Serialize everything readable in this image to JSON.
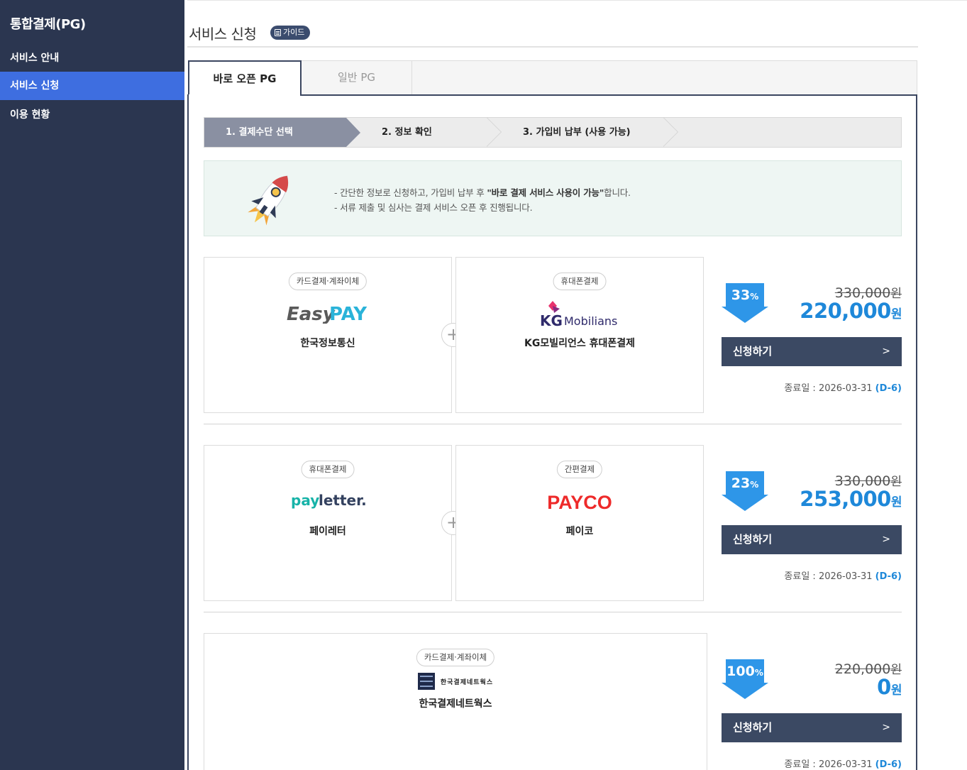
{
  "sidebar": {
    "title": "통합결제(PG)",
    "items": [
      {
        "label": "서비스 안내"
      },
      {
        "label": "서비스 신청"
      },
      {
        "label": "이용 현황"
      }
    ]
  },
  "header": {
    "title": "서비스 신청",
    "guide_label": "가이드"
  },
  "tabs": [
    {
      "label": "바로 오픈 PG"
    },
    {
      "label": "일반 PG"
    }
  ],
  "steps": [
    {
      "label": "1. 결제수단 선택"
    },
    {
      "label": "2. 정보 확인"
    },
    {
      "label": "3. 가입비 납부 (사용 가능)"
    }
  ],
  "info": {
    "line1_pre": "- 간단한 정보로 신청하고, 가입비 납부 후 ",
    "line1_bold": "\"바로 결제 서비스 사용이 가능\"",
    "line1_post": "합니다.",
    "line2": "- 서류 제출 및 심사는 결제 서비스 오픈 후 진행됩니다.",
    "rocket_label": "PG"
  },
  "offers": [
    {
      "cards": [
        {
          "tag": "카드결제·계좌이체",
          "logo": "Easy PAY",
          "name": "한국정보통신"
        },
        {
          "tag": "휴대폰결제",
          "logo": "Mobilians",
          "name": "KG모빌리언스 휴대폰결제"
        }
      ],
      "discount": "33",
      "discount_unit": "%",
      "original_price": "330,000",
      "price": "220,000",
      "currency": "원",
      "button_label": "신청하기",
      "end_label": "종료일 : 2026-03-31",
      "dday": "(D-6)"
    },
    {
      "cards": [
        {
          "tag": "휴대폰결제",
          "logo": "payletter.",
          "name": "페이레터"
        },
        {
          "tag": "간편결제",
          "logo": "PAYCO",
          "name": "페이코"
        }
      ],
      "discount": "23",
      "discount_unit": "%",
      "original_price": "330,000",
      "price": "253,000",
      "currency": "원",
      "button_label": "신청하기",
      "end_label": "종료일 : 2026-03-31",
      "dday": "(D-6)"
    },
    {
      "cards": [
        {
          "tag": "카드결제·계좌이체",
          "logo": "한국결제네트웍스",
          "name": "한국결제네트웍스"
        }
      ],
      "discount": "100",
      "discount_unit": "%",
      "original_price": "220,000",
      "price": "0",
      "currency": "원",
      "button_label": "신청하기",
      "end_label": "종료일 : 2026-03-31",
      "dday": "(D-6)"
    }
  ],
  "colors": {
    "sidebar_bg": "#2b3650",
    "active_blue": "#3e6ee0",
    "price_blue": "#1e88d9",
    "button_bg": "#3b4963"
  }
}
